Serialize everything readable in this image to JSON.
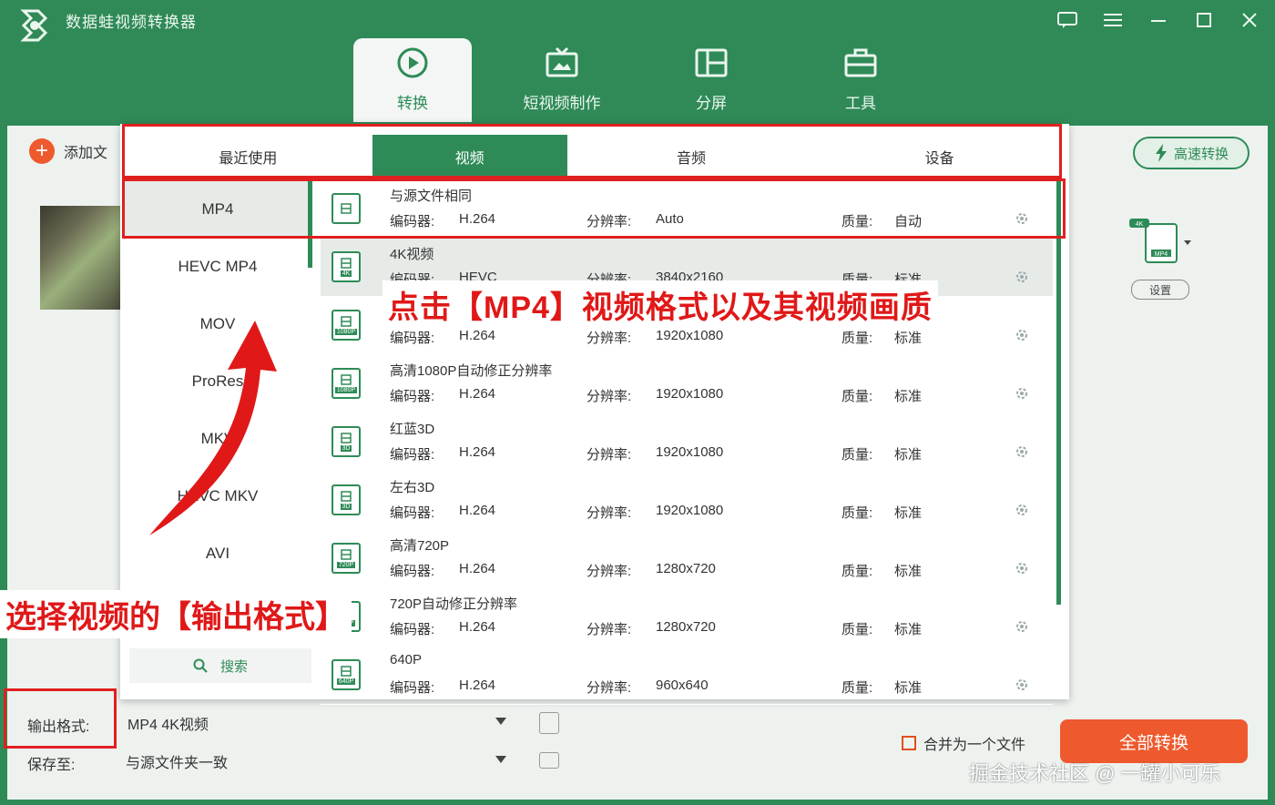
{
  "app": {
    "title": "数据蛙视频转换器"
  },
  "main_tabs": [
    {
      "label": "转换",
      "icon": "convert-icon"
    },
    {
      "label": "短视频制作",
      "icon": "tv-icon"
    },
    {
      "label": "分屏",
      "icon": "split-screen-icon"
    },
    {
      "label": "工具",
      "icon": "toolbox-icon"
    }
  ],
  "toolbar": {
    "add_file": "添加文",
    "fast_convert": "高速转换",
    "settings": "设置",
    "format_badge_top": "4K",
    "format_badge": "MP4"
  },
  "popup": {
    "tabs": [
      "最近使用",
      "视频",
      "音频",
      "设备"
    ],
    "active_tab": "视频",
    "sidebar": [
      "MP4",
      "HEVC MP4",
      "MOV",
      "ProRes",
      "MKV",
      "HEVC MKV",
      "AVI"
    ],
    "search_label": "搜索",
    "field_labels": {
      "encoder": "编码器:",
      "resolution": "分辨率:",
      "quality": "质量:"
    },
    "rows": [
      {
        "name": "与源文件相同",
        "encoder": "H.264",
        "resolution": "Auto",
        "quality": "自动",
        "tag": ""
      },
      {
        "name": "4K视频",
        "encoder": "HEVC",
        "resolution": "3840x2160",
        "quality": "标准",
        "tag": "4K"
      },
      {
        "name": "",
        "encoder": "H.264",
        "resolution": "1920x1080",
        "quality": "标准",
        "tag": "1080P"
      },
      {
        "name": "高清1080P自动修正分辨率",
        "encoder": "H.264",
        "resolution": "1920x1080",
        "quality": "标准",
        "tag": "1080P"
      },
      {
        "name": "红蓝3D",
        "encoder": "H.264",
        "resolution": "1920x1080",
        "quality": "标准",
        "tag": "3D"
      },
      {
        "name": "左右3D",
        "encoder": "H.264",
        "resolution": "1920x1080",
        "quality": "标准",
        "tag": "3D"
      },
      {
        "name": "高清720P",
        "encoder": "H.264",
        "resolution": "1280x720",
        "quality": "标准",
        "tag": "720P"
      },
      {
        "name": "720P自动修正分辨率",
        "encoder": "H.264",
        "resolution": "1280x720",
        "quality": "标准",
        "tag": "720P"
      },
      {
        "name": "640P",
        "encoder": "H.264",
        "resolution": "960x640",
        "quality": "标准",
        "tag": "640P"
      }
    ]
  },
  "annotations": {
    "click_mp4": "点击【MP4】视频格式以及其视频画质",
    "choose_output": "选择视频的【输出格式】"
  },
  "bottom": {
    "output_label": "输出格式:",
    "output_value": "MP4 4K视频",
    "save_label": "保存至:",
    "save_value": "与源文件夹一致",
    "merge_label": "合并为一个文件",
    "convert_all": "全部转换"
  },
  "watermark": "掘金技术社区 @ 一罐小可乐",
  "colors": {
    "brand": "#2e8b57",
    "accent": "#ee5a2e",
    "annotation": "#e02020"
  }
}
